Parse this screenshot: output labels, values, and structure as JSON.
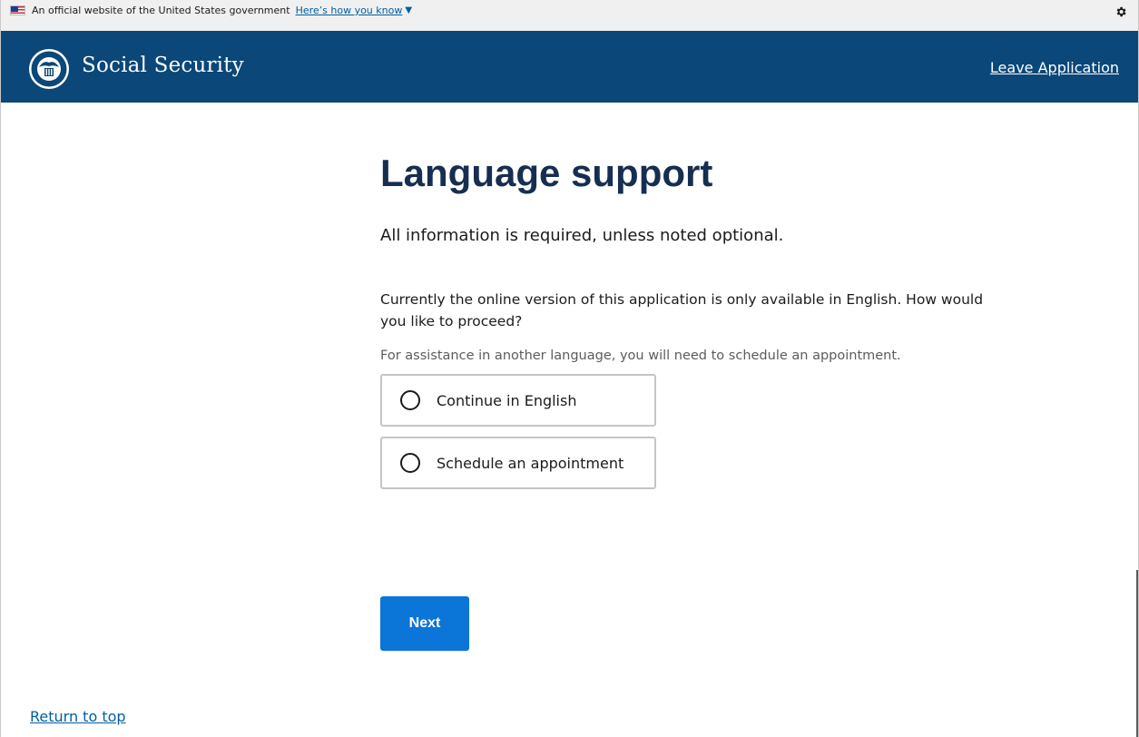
{
  "gov_banner": {
    "text": "An official website of the United States government",
    "link_label": "Here’s how you know",
    "chevron_icon": "chevron-down-icon",
    "settings_icon": "gear-icon"
  },
  "header": {
    "title": "Social Security",
    "leave_label": "Leave Application",
    "background_color": "#0b4778"
  },
  "main": {
    "title": "Language support",
    "required_note": "All information is required, unless noted optional.",
    "question": "Currently the online version of this application is only available in English. How would you like to proceed?",
    "hint": "For assistance in another language, you will need to schedule an appointment.",
    "options": [
      {
        "label": "Continue in English",
        "selected": false
      },
      {
        "label": "Schedule an appointment",
        "selected": false
      }
    ],
    "next_label": "Next"
  },
  "footer": {
    "return_label": "Return to top"
  },
  "colors": {
    "accent": "#0b75d8",
    "title": "#162e51",
    "link": "#005ea2"
  }
}
